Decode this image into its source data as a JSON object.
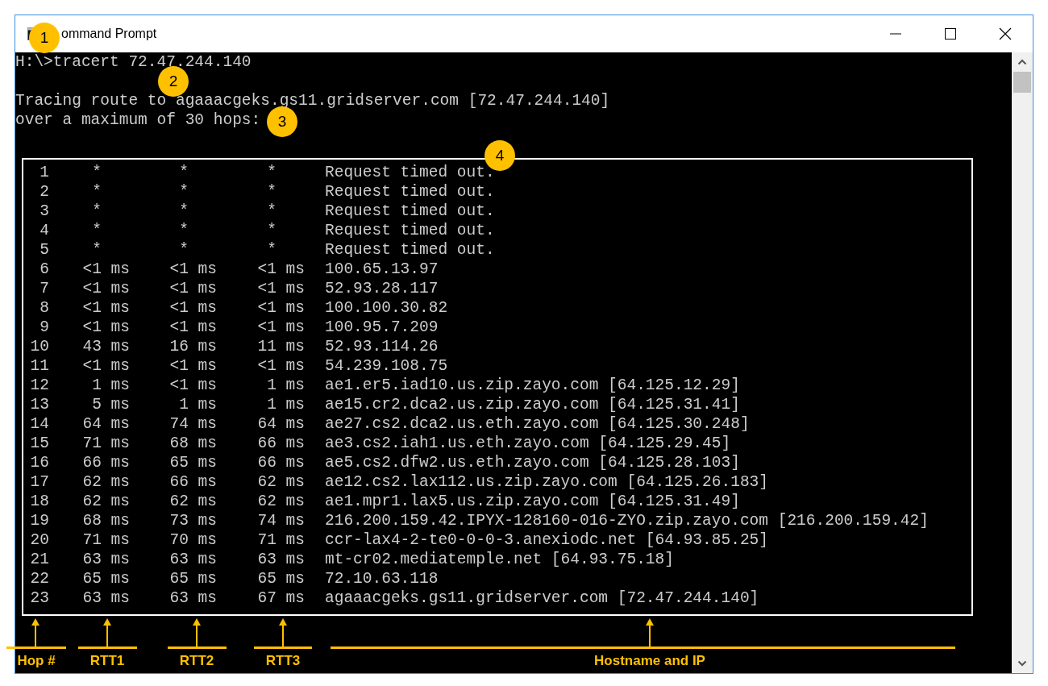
{
  "window": {
    "title": "ommand Prompt"
  },
  "console": {
    "lines": [
      {
        "text": "H:\\>tracert 72.47.244.140"
      },
      {
        "text": "Tracing route to agaaacgeks.gs11.gridserver.com [72.47.244.140]"
      },
      {
        "text": "over a maximum of 30 hops:"
      }
    ]
  },
  "hops": [
    {
      "hop": "1",
      "kind": "timeout",
      "rtt1": "*",
      "rtt2": "*",
      "rtt3": "*",
      "host": "Request timed out."
    },
    {
      "hop": "2",
      "kind": "timeout",
      "rtt1": "*",
      "rtt2": "*",
      "rtt3": "*",
      "host": "Request timed out."
    },
    {
      "hop": "3",
      "kind": "timeout",
      "rtt1": "*",
      "rtt2": "*",
      "rtt3": "*",
      "host": "Request timed out."
    },
    {
      "hop": "4",
      "kind": "timeout",
      "rtt1": "*",
      "rtt2": "*",
      "rtt3": "*",
      "host": "Request timed out."
    },
    {
      "hop": "5",
      "kind": "timeout",
      "rtt1": "*",
      "rtt2": "*",
      "rtt3": "*",
      "host": "Request timed out."
    },
    {
      "hop": "6",
      "kind": "reply",
      "rtt1": "<1 ms",
      "rtt2": "<1 ms",
      "rtt3": "<1 ms",
      "host": "100.65.13.97"
    },
    {
      "hop": "7",
      "kind": "reply",
      "rtt1": "<1 ms",
      "rtt2": "<1 ms",
      "rtt3": "<1 ms",
      "host": "52.93.28.117"
    },
    {
      "hop": "8",
      "kind": "reply",
      "rtt1": "<1 ms",
      "rtt2": "<1 ms",
      "rtt3": "<1 ms",
      "host": "100.100.30.82"
    },
    {
      "hop": "9",
      "kind": "reply",
      "rtt1": "<1 ms",
      "rtt2": "<1 ms",
      "rtt3": "<1 ms",
      "host": "100.95.7.209"
    },
    {
      "hop": "10",
      "kind": "reply",
      "rtt1": "43 ms",
      "rtt2": "16 ms",
      "rtt3": "11 ms",
      "host": "52.93.114.26"
    },
    {
      "hop": "11",
      "kind": "reply",
      "rtt1": "<1 ms",
      "rtt2": "<1 ms",
      "rtt3": "<1 ms",
      "host": "54.239.108.75"
    },
    {
      "hop": "12",
      "kind": "reply",
      "rtt1": "1 ms",
      "rtt2": "<1 ms",
      "rtt3": "1 ms",
      "host": "ae1.er5.iad10.us.zip.zayo.com [64.125.12.29]"
    },
    {
      "hop": "13",
      "kind": "reply",
      "rtt1": "5 ms",
      "rtt2": "1 ms",
      "rtt3": "1 ms",
      "host": "ae15.cr2.dca2.us.zip.zayo.com [64.125.31.41]"
    },
    {
      "hop": "14",
      "kind": "reply",
      "rtt1": "64 ms",
      "rtt2": "74 ms",
      "rtt3": "64 ms",
      "host": "ae27.cs2.dca2.us.eth.zayo.com [64.125.30.248]"
    },
    {
      "hop": "15",
      "kind": "reply",
      "rtt1": "71 ms",
      "rtt2": "68 ms",
      "rtt3": "66 ms",
      "host": "ae3.cs2.iah1.us.eth.zayo.com [64.125.29.45]"
    },
    {
      "hop": "16",
      "kind": "reply",
      "rtt1": "66 ms",
      "rtt2": "65 ms",
      "rtt3": "66 ms",
      "host": "ae5.cs2.dfw2.us.eth.zayo.com [64.125.28.103]"
    },
    {
      "hop": "17",
      "kind": "reply",
      "rtt1": "62 ms",
      "rtt2": "66 ms",
      "rtt3": "62 ms",
      "host": "ae12.cs2.lax112.us.zip.zayo.com [64.125.26.183]"
    },
    {
      "hop": "18",
      "kind": "reply",
      "rtt1": "62 ms",
      "rtt2": "62 ms",
      "rtt3": "62 ms",
      "host": "ae1.mpr1.lax5.us.zip.zayo.com [64.125.31.49]"
    },
    {
      "hop": "19",
      "kind": "reply",
      "rtt1": "68 ms",
      "rtt2": "73 ms",
      "rtt3": "74 ms",
      "host": "216.200.159.42.IPYX-128160-016-ZYO.zip.zayo.com [216.200.159.42]"
    },
    {
      "hop": "20",
      "kind": "reply",
      "rtt1": "71 ms",
      "rtt2": "70 ms",
      "rtt3": "71 ms",
      "host": "ccr-lax4-2-te0-0-0-3.anexiodc.net [64.93.85.25]"
    },
    {
      "hop": "21",
      "kind": "reply",
      "rtt1": "63 ms",
      "rtt2": "63 ms",
      "rtt3": "63 ms",
      "host": "mt-cr02.mediatemple.net [64.93.75.18]"
    },
    {
      "hop": "22",
      "kind": "reply",
      "rtt1": "65 ms",
      "rtt2": "65 ms",
      "rtt3": "65 ms",
      "host": "72.10.63.118"
    },
    {
      "hop": "23",
      "kind": "reply",
      "rtt1": "63 ms",
      "rtt2": "63 ms",
      "rtt3": "67 ms",
      "host": "agaaacgeks.gs11.gridserver.com [72.47.244.140]"
    }
  ],
  "callouts": [
    {
      "number": "1"
    },
    {
      "number": "2"
    },
    {
      "number": "3"
    },
    {
      "number": "4"
    }
  ],
  "column_labels": [
    {
      "text": "Hop #"
    },
    {
      "text": "RTT1"
    },
    {
      "text": "RTT2"
    },
    {
      "text": "RTT3"
    },
    {
      "text": "Hostname and IP"
    }
  ]
}
